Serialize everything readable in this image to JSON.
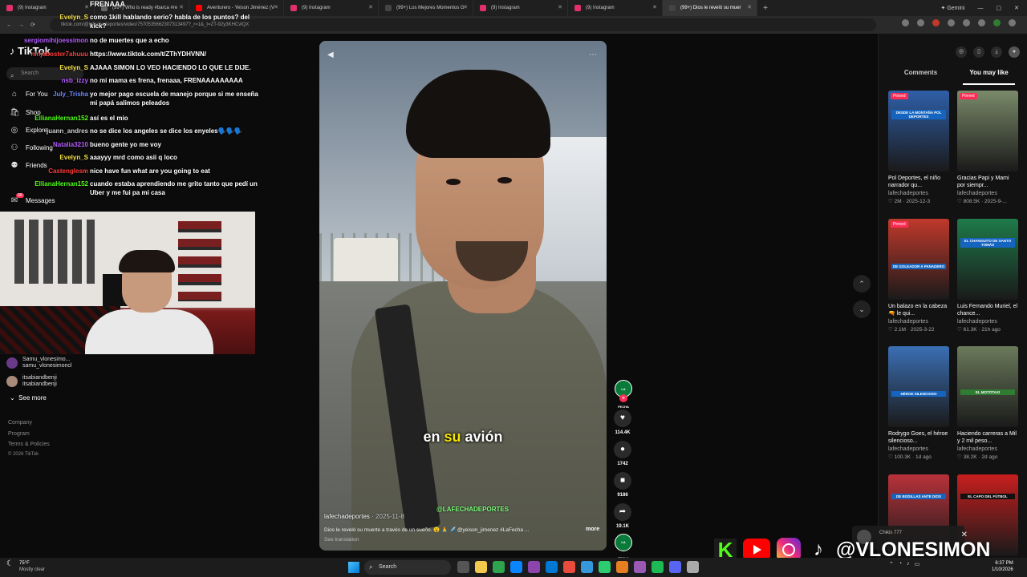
{
  "browser": {
    "tabs": [
      {
        "label": "(9) Instagram",
        "color": "#e1306c"
      },
      {
        "label": "(99+) Who is ready #barca #re",
        "color": "#666"
      },
      {
        "label": "Aventurero - Yeison Jiménez (V",
        "color": "#ff0000"
      },
      {
        "label": "(9) Instagram",
        "color": "#e1306c"
      },
      {
        "label": "(99+) Los Mejores Momentos G",
        "color": "#444"
      },
      {
        "label": "(9) Instagram",
        "color": "#e1306c"
      },
      {
        "label": "(9) Instagram",
        "color": "#e1306c"
      },
      {
        "label": "(99+) Dios le reveló su muer",
        "color": "#444"
      }
    ],
    "profile_label": "Gemini",
    "url": "tiktok.com/@lafechadeportes/video/7570535662307313497?_r=1&_t=ZT-92y3KHCvlQX"
  },
  "stream_title": "FRENAAA",
  "tiktok": {
    "logo": "TikTok",
    "search_placeholder": "Search",
    "nav": [
      {
        "label": "For You",
        "icon": "home-icon"
      },
      {
        "label": "Shop",
        "icon": "shop-icon"
      },
      {
        "label": "Explore",
        "icon": "compass-icon"
      },
      {
        "label": "Following",
        "icon": "following-icon"
      },
      {
        "label": "Friends",
        "icon": "friends-icon"
      },
      {
        "label": "Messages",
        "icon": "messages-icon",
        "badge": "99"
      }
    ],
    "following": [
      {
        "name": "Samu_vlonesimo...",
        "handle": "samu_vlonesimoncl"
      },
      {
        "name": "itsabiandbenji",
        "handle": "itsabiandbenji"
      }
    ],
    "see_more": "See more",
    "footer": [
      "Company",
      "Program",
      "Terms & Policies",
      "© 2026 TikTok"
    ]
  },
  "chat": [
    {
      "user": "Evelyn_S",
      "color": "#f5e04a",
      "text": "como 1kill hablando serio? habla de los puntos? del kick?"
    },
    {
      "user": "sergiomihijoessimon",
      "color": "#b35cff",
      "text": "no de muertes que a echo"
    },
    {
      "user": "ninjaboster7ahuuu",
      "color": "#ff3b3b",
      "text": "https://www.tiktok.com/t/ZThYDHVNN/"
    },
    {
      "user": "Evelyn_S",
      "color": "#f5e04a",
      "text": "AJAAA SIMON LO VEO HACIENDO LO QUE LE DIJE."
    },
    {
      "user": "nsb_izzy",
      "color": "#b35cff",
      "text": "no mi mama es frena, frenaaa, FRENAAAAAAAAA"
    },
    {
      "user": "July_Trisha",
      "color": "#6a8bff",
      "text": "yo mejor pago escuela de manejo porque si me enseña mi papá salimos peleados"
    },
    {
      "user": "EllianaHernan152",
      "color": "#53fc18",
      "text": "así es el mio"
    },
    {
      "user": "juann_andres",
      "color": "#cccccc",
      "text": "no se dice los angeles se dice los enyeles🗣️🗣️🗣️"
    },
    {
      "user": "Natalia3210",
      "color": "#b35cff",
      "text": "bueno gente yo me voy"
    },
    {
      "user": "Evelyn_S",
      "color": "#f5e04a",
      "text": "aaayyy mrd como asii q loco"
    },
    {
      "user": "Castenglesm",
      "color": "#ff3b3b",
      "text": "nice have fun what are you going to eat"
    },
    {
      "user": "EllianaHernan152",
      "color": "#53fc18",
      "text": "cuando estaba aprendiendo me grito tanto que pedí un Uber y me fui pa mi casa"
    }
  ],
  "video": {
    "caption_pre": "en ",
    "caption_hl": "su",
    "caption_post": " avión",
    "watermark": "@LAFECHADEPORTES",
    "author": "lafechadeportes",
    "date": "· 2025-11-8",
    "description": "Dios le reveló su muerte a través de un sueño. 😮 🙏 ✈️ @yeison_jimenez #LaFecha ...",
    "more": "more",
    "see_translation": "See translation",
    "avatar_label": "LA FECHA",
    "actions": [
      {
        "name": "like",
        "icon": "♥",
        "count": "114.4K"
      },
      {
        "name": "comment",
        "icon": "●",
        "count": "1742"
      },
      {
        "name": "save",
        "icon": "■",
        "count": "9186"
      },
      {
        "name": "share",
        "icon": "➦",
        "count": "19.1K"
      }
    ]
  },
  "right_panel": {
    "tabs": [
      "Comments",
      "You may like"
    ],
    "active_tab": "You may like",
    "cards": [
      {
        "pinned": "Pinned",
        "band": "DESDE LA MONTAÑA POL DEPORTES",
        "title": "Pol Deportes, el niño narrador qu...",
        "author": "lafechadeportes",
        "likes": "2M",
        "date": "2025-12-3",
        "bg": "#2f5fa8",
        "band_color": "#1565c0"
      },
      {
        "pinned": "Pinned",
        "band": "",
        "title": "Gracias Papi y Mami por siempr...",
        "author": "lafechadeportes",
        "likes": "808.5K",
        "date": "2025-9-...",
        "bg": "#7a8a6a",
        "band_color": "#000"
      },
      {
        "pinned": "Pinned",
        "band": "DE GOLEADOR A PANADERO",
        "title": "Un balazo en la cabeza 🔫 le qui...",
        "author": "lafechadeportes",
        "likes": "2.1M",
        "date": "2025-3-22",
        "bg": "#c0392b",
        "band_color": "#1565c0"
      },
      {
        "pinned": "",
        "band": "EL CHANGUITO DE SANTO TOMÁS",
        "title": "Luis Fernando Muriel, el chance...",
        "author": "lafechadeportes",
        "likes": "61.3K",
        "date": "21h ago",
        "bg": "#1e7a4a",
        "band_color": "#1565c0"
      },
      {
        "pinned": "",
        "band": "HÉROE SILENCIOSO",
        "title": "Rodrygo Goes, el héroe silencioso...",
        "author": "lafechadeportes",
        "likes": "100.3K",
        "date": "1d ago",
        "bg": "#3b6fb5",
        "band_color": "#1565c0"
      },
      {
        "pinned": "",
        "band": "EL MOTOTAXI",
        "title": "Haciendo carreras a Mil y 2 mil peso...",
        "author": "lafechadeportes",
        "likes": "38.2K",
        "date": "2d ago",
        "bg": "#6a7a5a",
        "band_color": "#2e7d32"
      },
      {
        "pinned": "",
        "band": "DE BODILLAS ANTE DIOS",
        "title": "",
        "author": "",
        "likes": "",
        "date": "",
        "bg": "#b8323a",
        "band_color": "#1565c0"
      },
      {
        "pinned": "",
        "band": "EL CAPO DEL FÚTBOL",
        "title": "",
        "author": "",
        "likes": "",
        "date": "",
        "bg": "#c81e1e",
        "band_color": "#111"
      }
    ]
  },
  "notification": {
    "name": "Chikis 777"
  },
  "socials": {
    "handle": "@VLONESIMON",
    "kick_letter": "K"
  },
  "taskbar": {
    "temp": "75°F",
    "weather": "Mostly clear",
    "search": "Search",
    "time": "6:37 PM",
    "date": "1/10/2026",
    "app_colors": [
      "#555",
      "#f2c94c",
      "#2ea44f",
      "#0a84ff",
      "#8e44ad",
      "#0078d4",
      "#e74c3c",
      "#3498db",
      "#2ecc71",
      "#e67e22",
      "#9b59b6",
      "#1db954",
      "#5865f2",
      "#aaa"
    ]
  }
}
